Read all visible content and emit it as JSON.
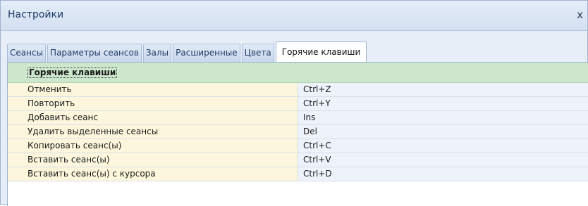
{
  "window": {
    "title": "Настройки",
    "close_glyph": "x"
  },
  "tabs": [
    {
      "label": "Сеансы"
    },
    {
      "label": "Параметры сеансов"
    },
    {
      "label": "Залы"
    },
    {
      "label": "Расширенные"
    },
    {
      "label": "Цвета"
    },
    {
      "label": "Горячие клавиши",
      "active": true
    }
  ],
  "group": {
    "header": "Горячие клавиши"
  },
  "hotkeys": [
    {
      "action": "Отменить",
      "key": "Ctrl+Z"
    },
    {
      "action": "Повторить",
      "key": "Ctrl+Y"
    },
    {
      "action": "Добавить сеанс",
      "key": "Ins"
    },
    {
      "action": "Удалить выделенные сеансы",
      "key": "Del"
    },
    {
      "action": "Копировать сеанс(ы)",
      "key": "Ctrl+C"
    },
    {
      "action": "Вставить сеанс(ы)",
      "key": "Ctrl+V"
    },
    {
      "action": "Вставить сеанс(ы) с курсора",
      "key": "Ctrl+D"
    }
  ],
  "colors": {
    "title_text": "#1f3d66",
    "group_header_bg": "#cde7cd",
    "action_cell_bg": "#fbf6dc",
    "key_cell_bg": "#eef3fb"
  }
}
